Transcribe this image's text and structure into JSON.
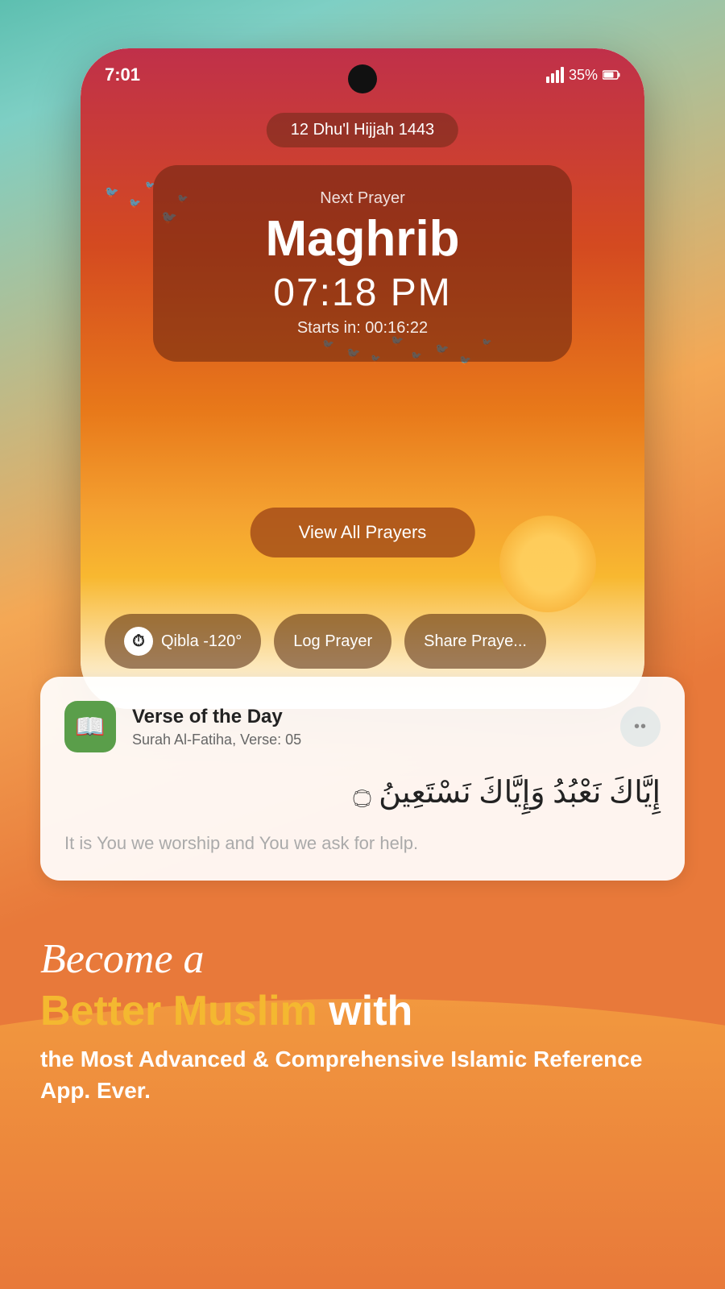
{
  "background": {
    "gradient_start": "#5dbfb0",
    "gradient_end": "#e8793a"
  },
  "status_bar": {
    "time": "7:01",
    "signal_bars": 4,
    "battery_percent": "35%"
  },
  "date_pill": {
    "text": "12 Dhu'l Hijjah 1443"
  },
  "prayer_card": {
    "label": "Next Prayer",
    "name": "Maghrib",
    "time": "07:18 PM",
    "starts_in": "Starts in: 00:16:22"
  },
  "view_prayers_button": {
    "label": "View All Prayers"
  },
  "action_buttons": [
    {
      "id": "qibla",
      "label": "Qibla -120°",
      "has_compass": true
    },
    {
      "id": "log",
      "label": "Log Prayer",
      "has_compass": false
    },
    {
      "id": "share",
      "label": "Share Praye...",
      "has_compass": false
    }
  ],
  "verse_card": {
    "title": "Verse of the Day",
    "subtitle": "Surah Al-Fatiha, Verse: 05",
    "arabic": "إِيَّاكَ نَعْبُدُ وَإِيَّاكَ نَسْتَعِينُ ۝",
    "translation": "It is You we worship and You we ask for help."
  },
  "tagline": {
    "become_script": "Become a",
    "better_muslim": "Better Muslim",
    "with": "with",
    "subtitle": "the Most Advanced & Comprehensive Islamic Reference App. Ever."
  }
}
